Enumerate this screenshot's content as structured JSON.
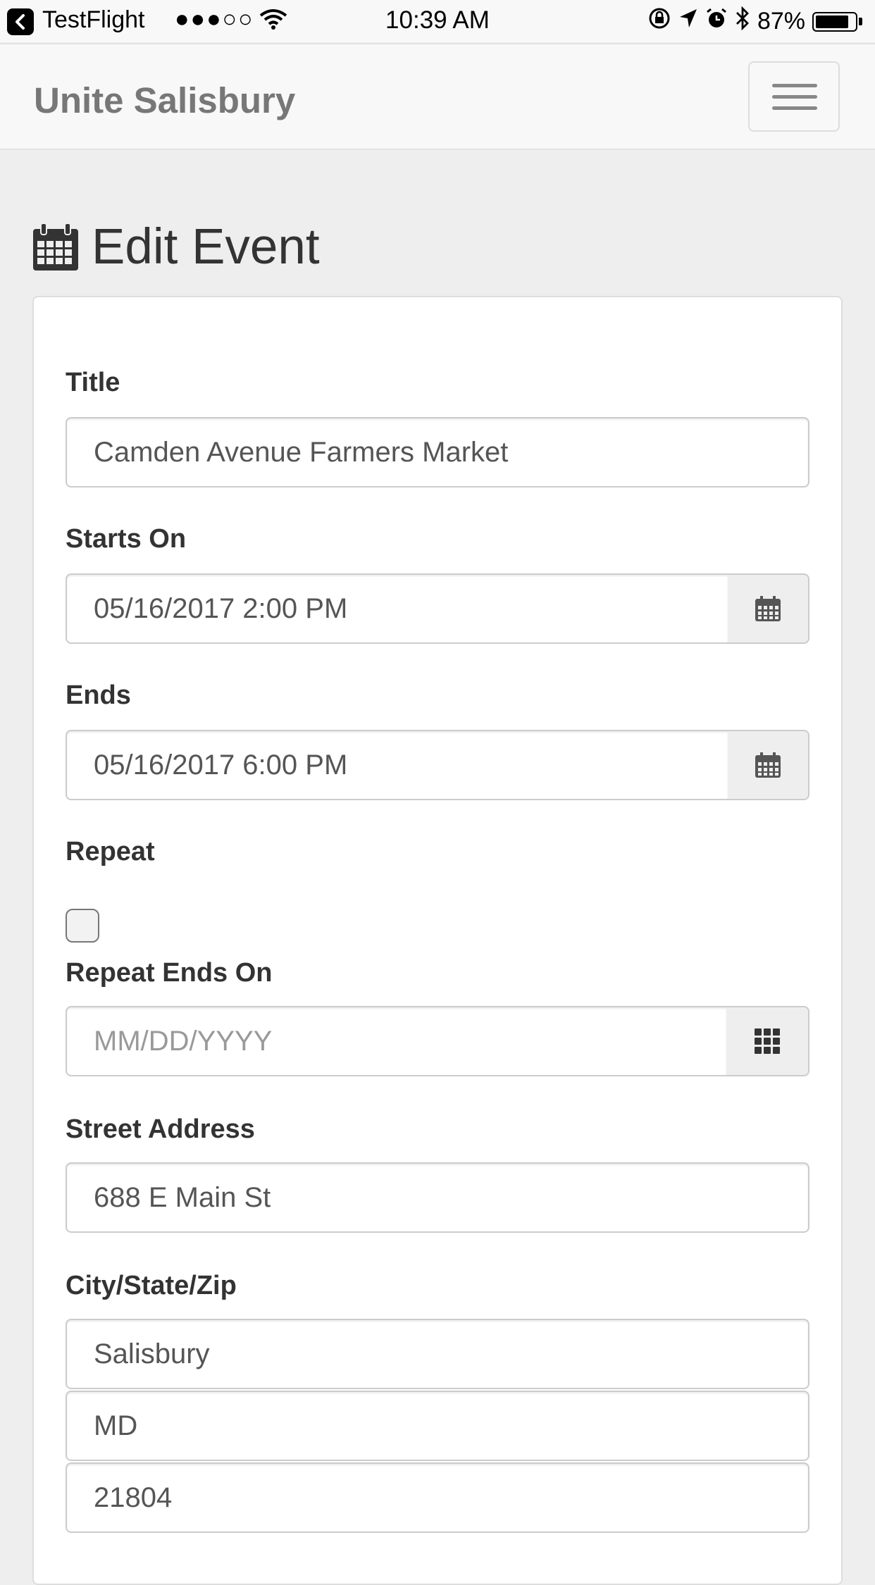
{
  "status_bar": {
    "back_app": "TestFlight",
    "signal": "●●●○○",
    "time": "10:39 AM",
    "battery": "87%",
    "battery_level": 0.87
  },
  "navbar": {
    "brand": "Unite Salisbury"
  },
  "page": {
    "title": "Edit Event"
  },
  "form": {
    "title_label": "Title",
    "title_value": "Camden Avenue Farmers Market",
    "starts_label": "Starts On",
    "starts_value": "05/16/2017 2:00 PM",
    "ends_label": "Ends",
    "ends_value": "05/16/2017 6:00 PM",
    "repeat_label": "Repeat",
    "repeat_checked": false,
    "repeat_ends_label": "Repeat Ends On",
    "repeat_ends_placeholder": "MM/DD/YYYY",
    "street_label": "Street Address",
    "street_value": "688 E Main St",
    "city_state_zip_label": "City/State/Zip",
    "city_value": "Salisbury",
    "state_value": "MD",
    "zip_value": "21804"
  },
  "icons": {
    "status_back": "back-arrow-icon",
    "wifi": "wifi-icon",
    "orientation_lock": "orientation-lock-icon",
    "location": "location-icon",
    "alarm": "alarm-icon",
    "bluetooth": "bluetooth-icon",
    "battery": "battery-icon",
    "menu": "hamburger-menu-icon",
    "heading": "calendar-icon",
    "date_picker": "calendar-icon",
    "repeat_picker": "grid-icon"
  }
}
